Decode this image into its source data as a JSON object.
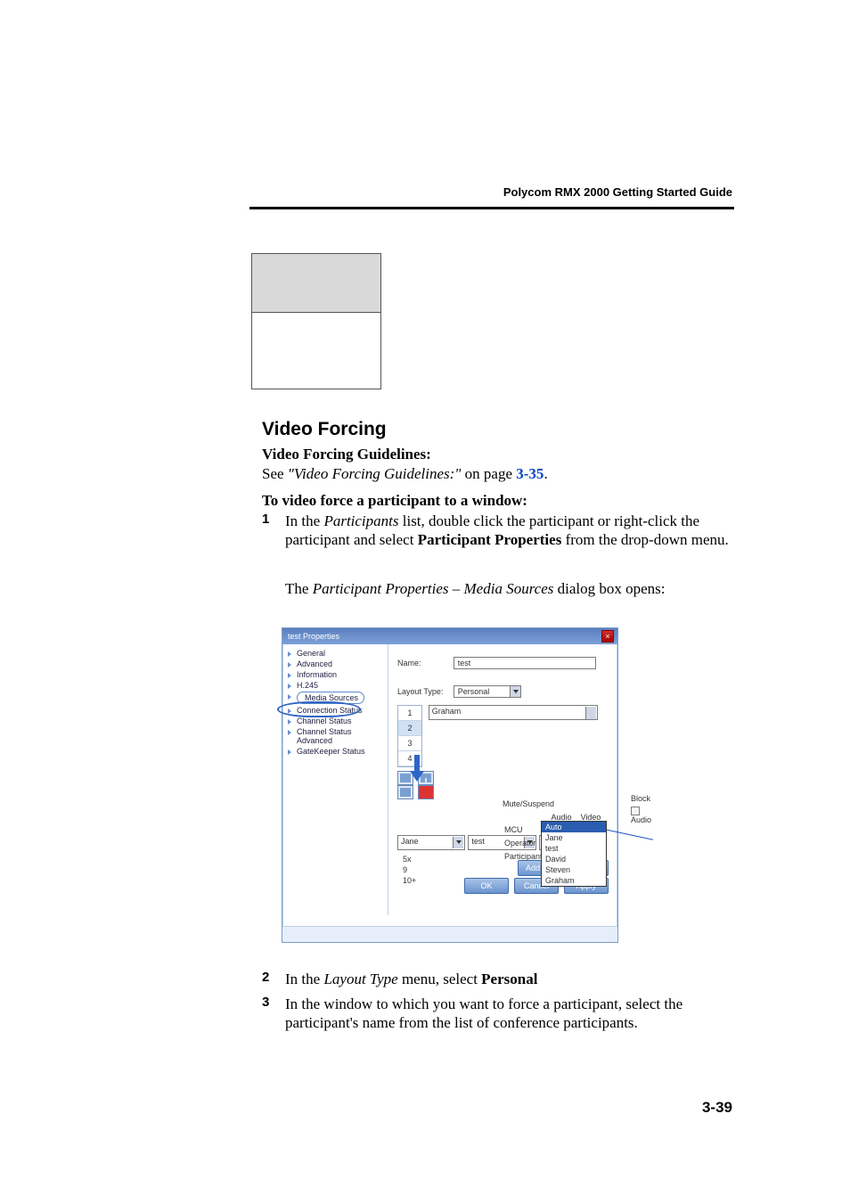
{
  "header": {
    "guide_title": "Polycom RMX 2000 Getting Started Guide"
  },
  "section": {
    "heading": "Video Forcing"
  },
  "guidelines": {
    "title": "Video Forcing Guidelines:",
    "see_prefix": "See ",
    "see_quote": "\"Video Forcing Guidelines:\"",
    "see_mid": " on page ",
    "see_link": "3-35",
    "see_suffix": "."
  },
  "procedure": {
    "title": "To video force a participant to a window:",
    "steps": [
      {
        "num": "1",
        "pre": "In the ",
        "italic1": "Participants",
        "mid1": " list, double click the participant or right-click the participant and select ",
        "bold1": "Participant Properties",
        "post1": " from the drop-down menu.",
        "follow_pre": "The ",
        "follow_italic": "Participant Properties – Media Sources",
        "follow_post": " dialog box opens:"
      },
      {
        "num": "2",
        "pre": "In the ",
        "italic1": "Layout Type",
        "mid1": " menu, select ",
        "bold1": "Personal"
      },
      {
        "num": "3",
        "text": "In the window to which you want to force a participant, select the participant's name from the list of conference participants."
      }
    ]
  },
  "dialog": {
    "title": "test Properties",
    "nav": [
      "General",
      "Advanced",
      "Information",
      "H.245",
      "Media Sources",
      "Connection Status",
      "Channel Status",
      "Channel Status Advanced",
      "GateKeeper Status"
    ],
    "name_label": "Name:",
    "name_value": "test",
    "layout_label": "Layout Type:",
    "layout_value": "Personal",
    "side_numbers": [
      "1",
      "2",
      "3",
      "4"
    ],
    "big_select_value": "Graham",
    "trio": [
      "Jane",
      "test",
      "Auto"
    ],
    "nums2": [
      "5x",
      "9",
      "10+"
    ],
    "dropdown_list": [
      "Auto",
      "Jane",
      "test",
      "David",
      "Steven",
      "Graham"
    ],
    "mute_suspend": {
      "label": "Mute/Suspend",
      "cols": [
        "Audio",
        "Video"
      ],
      "rows": [
        "MCU",
        "Operator",
        "Participant"
      ]
    },
    "block": {
      "label": "Block",
      "audio": "Audio"
    },
    "buttons": {
      "addr": "Add to Address Book",
      "ok": "OK",
      "cancel": "Cancel",
      "apply": "Apply"
    }
  },
  "footer": {
    "page": "3-39"
  }
}
